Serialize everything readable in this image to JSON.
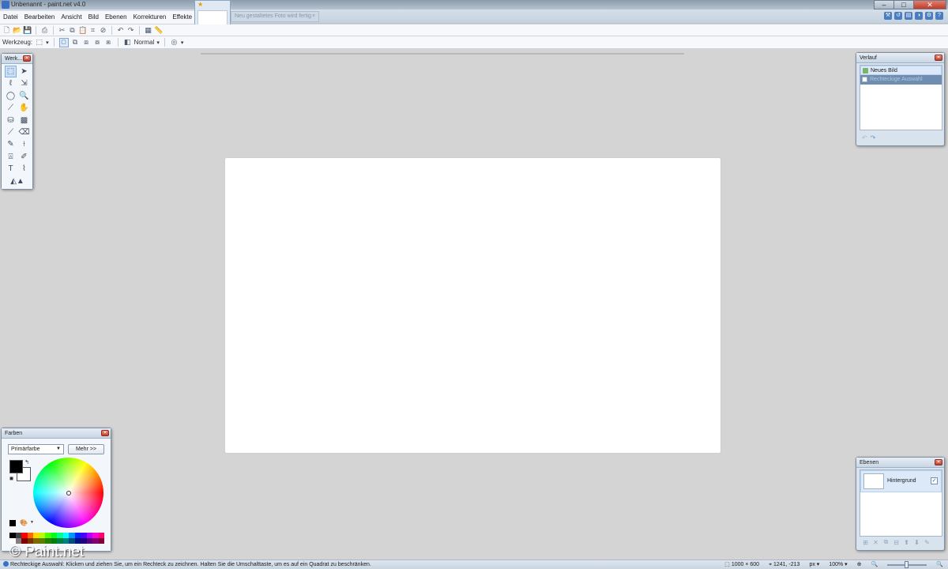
{
  "window": {
    "title": "Unbenannt - paint.net v4.0",
    "controls": {
      "minimize": "–",
      "maximize": "□",
      "close": "✕"
    }
  },
  "menu": {
    "items": [
      "Datei",
      "Bearbeiten",
      "Ansicht",
      "Bild",
      "Ebenen",
      "Korrekturen",
      "Effekte"
    ]
  },
  "tabs": {
    "ghost_label": "Neu gestaltetes Foto wird fertig",
    "ghost_close": "×"
  },
  "toolbar": {
    "tool_label": "Werkzeug:",
    "blend_mode": "Normal"
  },
  "tools_window": {
    "title": "Werk...",
    "tools": [
      "rectangle-select",
      "move-selection",
      "lasso-select",
      "move-selected",
      "ellipse-select",
      "zoom",
      "magic-wand",
      "pan",
      "paint-bucket",
      "gradient",
      "paintbrush",
      "eraser",
      "pencil",
      "color-picker",
      "clone-stamp",
      "recolor",
      "text",
      "line-curve",
      "shapes"
    ]
  },
  "history_window": {
    "title": "Verlauf",
    "items": [
      "Neues Bild",
      "Rechteckige Auswahl"
    ]
  },
  "layers_window": {
    "title": "Ebenen",
    "layers": [
      {
        "name": "Hintergrund",
        "visible": true
      }
    ]
  },
  "colors_window": {
    "title": "Farben",
    "selector": "Primärfarbe",
    "more_button": "Mehr >>",
    "primary_color": "#000000",
    "secondary_color": "#ffffff",
    "palette": [
      "#000000",
      "#404040",
      "#ff0000",
      "#ff6a00",
      "#ffd800",
      "#b6ff00",
      "#4cff00",
      "#00ff21",
      "#00ff90",
      "#00ffff",
      "#0094ff",
      "#0026ff",
      "#4800ff",
      "#b200ff",
      "#ff00dc",
      "#ff006e",
      "#ffffff",
      "#808080",
      "#7f0000",
      "#7f3300",
      "#7f6a00",
      "#5b7f00",
      "#267f00",
      "#007f0e",
      "#007f46",
      "#007f7f",
      "#004a7f",
      "#00137f",
      "#21007f",
      "#57007f",
      "#7f006e",
      "#7f0037"
    ]
  },
  "watermark": "© Paint.net",
  "statusbar": {
    "hint": "Rechteckige Auswahl: Klicken und ziehen Sie, um ein Rechteck zu zeichnen. Halten Sie die Umschalttaste, um es auf ein Quadrat zu beschränken.",
    "image_size": "1000 × 600",
    "cursor_pos": "1241, -213",
    "units": "px",
    "zoom": "100%"
  },
  "colors": {
    "accent": "#3a6fc4",
    "workspace": "#d4d4d4",
    "canvas": "#ffffff"
  }
}
